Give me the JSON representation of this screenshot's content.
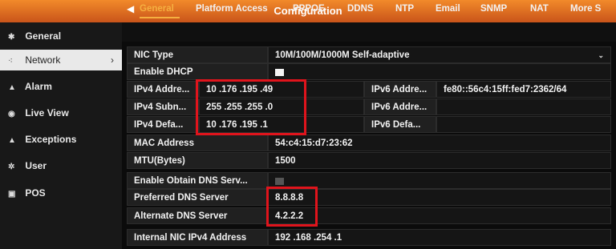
{
  "window": {
    "title": "Configuration"
  },
  "sidebar": {
    "items": [
      {
        "icon": "gear-icon",
        "glyph": "✱",
        "label": "General"
      },
      {
        "icon": "network-icon",
        "glyph": "⁖",
        "label": "Network",
        "active": true,
        "chevron": "›"
      },
      {
        "icon": "alarm-icon",
        "glyph": "▲",
        "label": "Alarm"
      },
      {
        "icon": "eye-icon",
        "glyph": "◉",
        "label": "Live View"
      },
      {
        "icon": "warning-icon",
        "glyph": "▲",
        "label": "Exceptions"
      },
      {
        "icon": "user-icon",
        "glyph": "✲",
        "label": "User"
      },
      {
        "icon": "pos-icon",
        "glyph": "▣",
        "label": "POS"
      }
    ]
  },
  "tabs": {
    "prev_arrow": "◀",
    "items": [
      "General",
      "Platform Access",
      "PPPOE",
      "DDNS",
      "NTP",
      "Email",
      "SNMP",
      "NAT",
      "More S"
    ],
    "active": "General"
  },
  "form": {
    "nic_type": {
      "label": "NIC Type",
      "value": "10M/100M/1000M Self-adaptive",
      "caret": "⌄"
    },
    "enable_dhcp": {
      "label": "Enable DHCP",
      "checked": true
    },
    "ipv4_address": {
      "label": "IPv4 Addre...",
      "value": "10  .176 .195 .49"
    },
    "ipv6_address": {
      "label": "IPv6 Addre...",
      "value": "fe80::56c4:15ff:fed7:2362/64"
    },
    "ipv4_subnet": {
      "label": "IPv4 Subn...",
      "value": "255 .255 .255 .0"
    },
    "ipv6_address2": {
      "label": "IPv6 Addre...",
      "value": ""
    },
    "ipv4_gateway": {
      "label": "IPv4 Defa...",
      "value": "10  .176 .195 .1"
    },
    "ipv6_gateway": {
      "label": "IPv6 Defa...",
      "value": ""
    },
    "mac_address": {
      "label": "MAC Address",
      "value": "54:c4:15:d7:23:62"
    },
    "mtu": {
      "label": "MTU(Bytes)",
      "value": "1500"
    },
    "enable_obtain_dns": {
      "label": "Enable Obtain DNS Serv...",
      "checked": false
    },
    "preferred_dns": {
      "label": "Preferred DNS Server",
      "value": "8.8.8.8"
    },
    "alternate_dns": {
      "label": "Alternate DNS Server",
      "value": "4.2.2.2"
    },
    "internal_nic_ipv4": {
      "label": "Internal NIC IPv4 Address",
      "value": "192 .168 .254 .1"
    }
  },
  "colors": {
    "accent": "#f5b040",
    "titlebar": "#e06e22",
    "highlight_box": "#e0141c"
  }
}
